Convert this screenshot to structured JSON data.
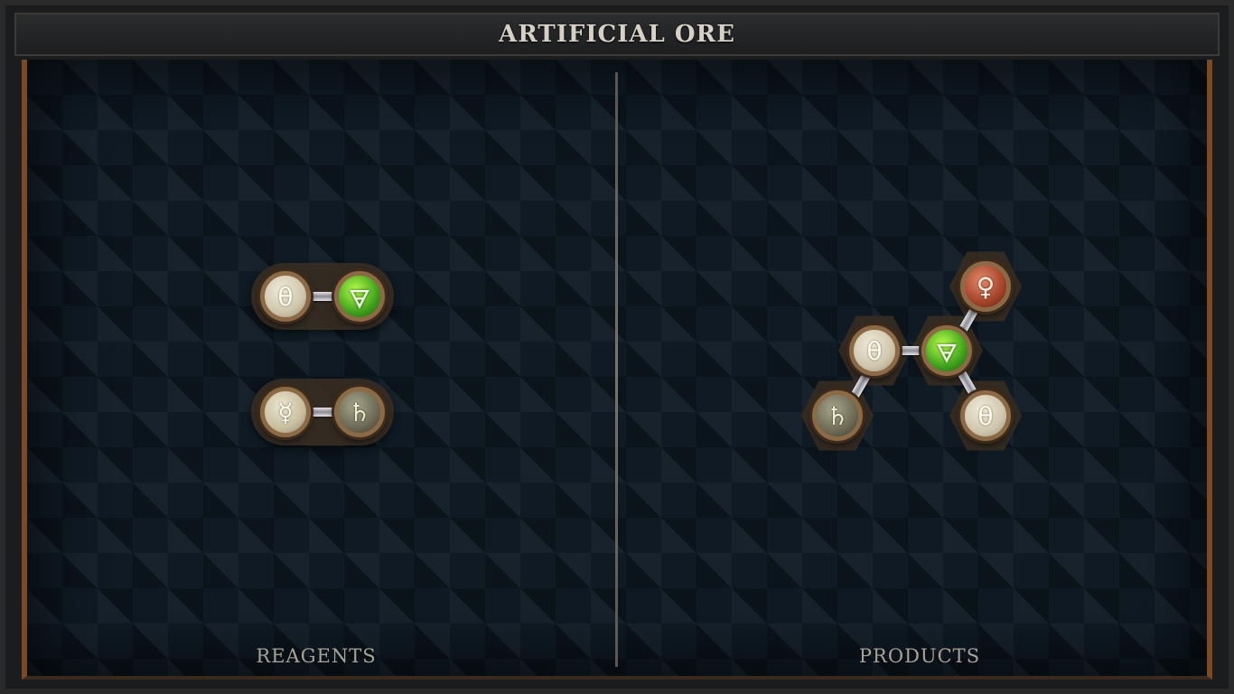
{
  "title": "ARTIFICIAL ORE",
  "panels": {
    "reagents_label": "REAGENTS",
    "products_label": "PRODUCTS"
  },
  "symbols": {
    "salt": "θ",
    "earth": "🜃",
    "quicksilver": "☿",
    "lead": "♄",
    "copper": "♀"
  },
  "reagents": [
    {
      "atoms": [
        "salt",
        "earth"
      ]
    },
    {
      "atoms": [
        "quicksilver",
        "lead"
      ]
    }
  ],
  "products": [
    {
      "atoms": [
        "copper",
        "salt",
        "earth",
        "lead",
        "salt"
      ]
    }
  ],
  "colors": {
    "frame_accent": "#7a4a24",
    "board": "#0f1a24",
    "earth_green": "#3fa11c",
    "copper_red": "#a4432a"
  }
}
